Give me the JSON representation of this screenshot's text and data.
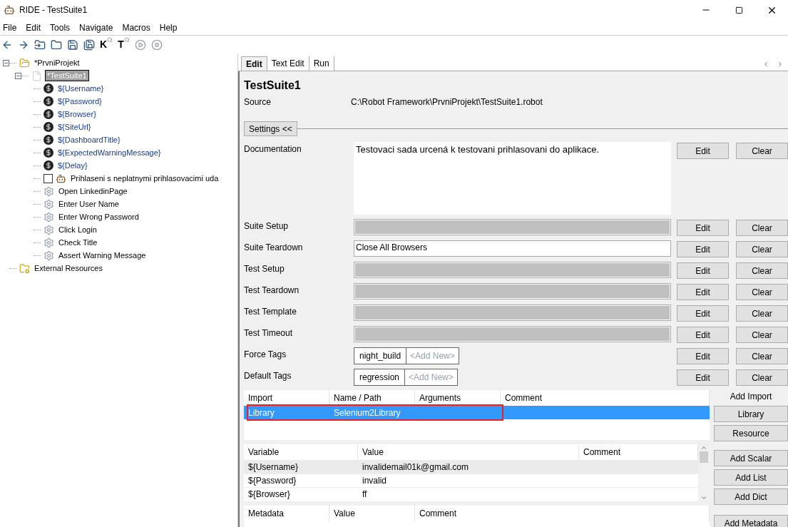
{
  "window": {
    "title": "RIDE - TestSuite1"
  },
  "menu": [
    "File",
    "Edit",
    "Tools",
    "Navigate",
    "Macros",
    "Help"
  ],
  "toolbar": [
    {
      "kind": "back",
      "disabled": false
    },
    {
      "kind": "forward",
      "disabled": false
    },
    {
      "kind": "open-suite",
      "disabled": false
    },
    {
      "kind": "open-dir",
      "disabled": false
    },
    {
      "kind": "save",
      "disabled": false
    },
    {
      "kind": "save-all",
      "disabled": false
    },
    {
      "kind": "search",
      "glyph": "K",
      "disabled": false
    },
    {
      "kind": "search",
      "glyph": "T",
      "disabled": false
    },
    {
      "kind": "play",
      "disabled": true
    },
    {
      "kind": "stop",
      "disabled": true
    }
  ],
  "tree": [
    {
      "kind": "folder",
      "label": "*PrvniProjekt",
      "selected": false,
      "expanded": true,
      "children": [
        {
          "kind": "suite",
          "label": "*TestSuite1",
          "selected": true,
          "expanded": true,
          "children": [
            {
              "kind": "variable",
              "label": "${Username}",
              "selected": false
            },
            {
              "kind": "variable",
              "label": "${Password}",
              "selected": false
            },
            {
              "kind": "variable",
              "label": "${Browser}",
              "selected": false
            },
            {
              "kind": "variable",
              "label": "${SiteUrl}",
              "selected": false
            },
            {
              "kind": "variable",
              "label": "${DashboardTitle}",
              "selected": false
            },
            {
              "kind": "variable",
              "label": "${ExpectedWarningMessage}",
              "selected": false
            },
            {
              "kind": "variable",
              "label": "${Delay}",
              "selected": false
            },
            {
              "kind": "test",
              "label": "Prihlaseni s neplatnymi prihlasovacimi uda",
              "selected": false,
              "checked": false
            },
            {
              "kind": "keyword",
              "label": "Open LinkedinPage",
              "selected": false
            },
            {
              "kind": "keyword",
              "label": "Enter User Name",
              "selected": false
            },
            {
              "kind": "keyword",
              "label": "Enter Wrong Password",
              "selected": false
            },
            {
              "kind": "keyword",
              "label": "Click Login",
              "selected": false
            },
            {
              "kind": "keyword",
              "label": "Check Title",
              "selected": false
            },
            {
              "kind": "keyword",
              "label": "Assert Warning Message",
              "selected": false
            }
          ]
        }
      ]
    },
    {
      "kind": "resources",
      "label": "External Resources",
      "selected": false
    }
  ],
  "tabs": [
    {
      "label": "Edit",
      "selected": true
    },
    {
      "label": "Text Edit",
      "selected": false
    },
    {
      "label": "Run",
      "selected": false
    }
  ],
  "editor": {
    "title": "TestSuite1",
    "source_label": "Source",
    "source": "C:\\Robot Framework\\PrvniProjekt\\TestSuite1.robot",
    "settings_toggle": "Settings <<",
    "settings": [
      {
        "kind": "documentation",
        "label": "Documentation",
        "value": "Testovaci sada urcená k testovani prihlasovani do aplikace.",
        "buttons": [
          "Edit",
          "Clear"
        ]
      },
      {
        "kind": "text",
        "label": "Suite Setup",
        "buttons": [
          "Edit",
          "Clear"
        ]
      },
      {
        "kind": "text",
        "label": "Suite Teardown",
        "value": "Close All Browsers",
        "buttons": [
          "Edit",
          "Clear"
        ]
      },
      {
        "kind": "text",
        "label": "Test Setup",
        "buttons": [
          "Edit",
          "Clear"
        ]
      },
      {
        "kind": "text",
        "label": "Test Teardown",
        "buttons": [
          "Edit",
          "Clear"
        ]
      },
      {
        "kind": "text",
        "label": "Test Template",
        "buttons": [
          "Edit",
          "Clear"
        ]
      },
      {
        "kind": "text",
        "label": "Test Timeout",
        "buttons": [
          "Edit",
          "Clear"
        ]
      },
      {
        "kind": "tags",
        "label": "Force Tags",
        "tags": [
          "night_build"
        ],
        "add_placeholder": "<Add New>",
        "buttons": [
          "Edit",
          "Clear"
        ]
      },
      {
        "kind": "tags",
        "label": "Default Tags",
        "tags": [
          "regression"
        ],
        "add_placeholder": "<Add New>",
        "buttons": [
          "Edit",
          "Clear"
        ]
      }
    ],
    "imports": {
      "columns": [
        "Import",
        "Name / Path",
        "Arguments",
        "Comment"
      ],
      "rows": [
        {
          "cells": [
            "Library",
            "Selenium2Library"
          ],
          "selected": true,
          "outlined": true
        }
      ],
      "caption": "Add Import",
      "buttons": [
        "Library",
        "Resource"
      ]
    },
    "variables": {
      "columns": [
        "Variable",
        "Value",
        "Comment"
      ],
      "rows": [
        {
          "cells": [
            "${Username}",
            "invalidemail01k@gmail.com"
          ],
          "selected": true
        },
        {
          "cells": [
            "${Password}",
            "invalid"
          ],
          "selected": false
        },
        {
          "cells": [
            "${Browser}",
            "ff"
          ],
          "selected": false
        }
      ],
      "buttons": [
        "Add Scalar",
        "Add List",
        "Add Dict"
      ]
    },
    "metadata": {
      "columns": [
        "Metadata",
        "Value",
        "Comment"
      ],
      "buttons": [
        "Add Metadata"
      ]
    }
  }
}
